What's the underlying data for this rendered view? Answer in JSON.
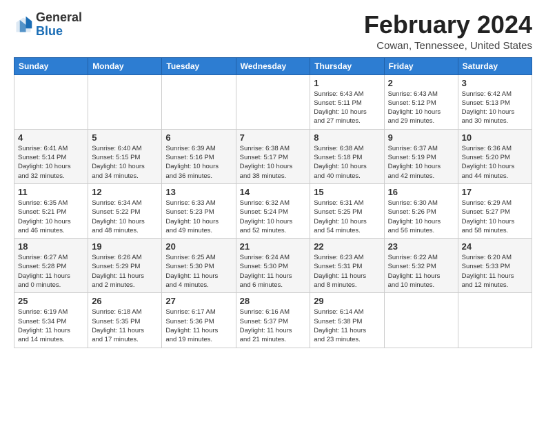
{
  "header": {
    "logo_general": "General",
    "logo_blue": "Blue",
    "month_title": "February 2024",
    "location": "Cowan, Tennessee, United States"
  },
  "calendar": {
    "days_of_week": [
      "Sunday",
      "Monday",
      "Tuesday",
      "Wednesday",
      "Thursday",
      "Friday",
      "Saturday"
    ],
    "weeks": [
      [
        {
          "day": "",
          "info": ""
        },
        {
          "day": "",
          "info": ""
        },
        {
          "day": "",
          "info": ""
        },
        {
          "day": "",
          "info": ""
        },
        {
          "day": "1",
          "info": "Sunrise: 6:43 AM\nSunset: 5:11 PM\nDaylight: 10 hours\nand 27 minutes."
        },
        {
          "day": "2",
          "info": "Sunrise: 6:43 AM\nSunset: 5:12 PM\nDaylight: 10 hours\nand 29 minutes."
        },
        {
          "day": "3",
          "info": "Sunrise: 6:42 AM\nSunset: 5:13 PM\nDaylight: 10 hours\nand 30 minutes."
        }
      ],
      [
        {
          "day": "4",
          "info": "Sunrise: 6:41 AM\nSunset: 5:14 PM\nDaylight: 10 hours\nand 32 minutes."
        },
        {
          "day": "5",
          "info": "Sunrise: 6:40 AM\nSunset: 5:15 PM\nDaylight: 10 hours\nand 34 minutes."
        },
        {
          "day": "6",
          "info": "Sunrise: 6:39 AM\nSunset: 5:16 PM\nDaylight: 10 hours\nand 36 minutes."
        },
        {
          "day": "7",
          "info": "Sunrise: 6:38 AM\nSunset: 5:17 PM\nDaylight: 10 hours\nand 38 minutes."
        },
        {
          "day": "8",
          "info": "Sunrise: 6:38 AM\nSunset: 5:18 PM\nDaylight: 10 hours\nand 40 minutes."
        },
        {
          "day": "9",
          "info": "Sunrise: 6:37 AM\nSunset: 5:19 PM\nDaylight: 10 hours\nand 42 minutes."
        },
        {
          "day": "10",
          "info": "Sunrise: 6:36 AM\nSunset: 5:20 PM\nDaylight: 10 hours\nand 44 minutes."
        }
      ],
      [
        {
          "day": "11",
          "info": "Sunrise: 6:35 AM\nSunset: 5:21 PM\nDaylight: 10 hours\nand 46 minutes."
        },
        {
          "day": "12",
          "info": "Sunrise: 6:34 AM\nSunset: 5:22 PM\nDaylight: 10 hours\nand 48 minutes."
        },
        {
          "day": "13",
          "info": "Sunrise: 6:33 AM\nSunset: 5:23 PM\nDaylight: 10 hours\nand 49 minutes."
        },
        {
          "day": "14",
          "info": "Sunrise: 6:32 AM\nSunset: 5:24 PM\nDaylight: 10 hours\nand 52 minutes."
        },
        {
          "day": "15",
          "info": "Sunrise: 6:31 AM\nSunset: 5:25 PM\nDaylight: 10 hours\nand 54 minutes."
        },
        {
          "day": "16",
          "info": "Sunrise: 6:30 AM\nSunset: 5:26 PM\nDaylight: 10 hours\nand 56 minutes."
        },
        {
          "day": "17",
          "info": "Sunrise: 6:29 AM\nSunset: 5:27 PM\nDaylight: 10 hours\nand 58 minutes."
        }
      ],
      [
        {
          "day": "18",
          "info": "Sunrise: 6:27 AM\nSunset: 5:28 PM\nDaylight: 11 hours\nand 0 minutes."
        },
        {
          "day": "19",
          "info": "Sunrise: 6:26 AM\nSunset: 5:29 PM\nDaylight: 11 hours\nand 2 minutes."
        },
        {
          "day": "20",
          "info": "Sunrise: 6:25 AM\nSunset: 5:30 PM\nDaylight: 11 hours\nand 4 minutes."
        },
        {
          "day": "21",
          "info": "Sunrise: 6:24 AM\nSunset: 5:30 PM\nDaylight: 11 hours\nand 6 minutes."
        },
        {
          "day": "22",
          "info": "Sunrise: 6:23 AM\nSunset: 5:31 PM\nDaylight: 11 hours\nand 8 minutes."
        },
        {
          "day": "23",
          "info": "Sunrise: 6:22 AM\nSunset: 5:32 PM\nDaylight: 11 hours\nand 10 minutes."
        },
        {
          "day": "24",
          "info": "Sunrise: 6:20 AM\nSunset: 5:33 PM\nDaylight: 11 hours\nand 12 minutes."
        }
      ],
      [
        {
          "day": "25",
          "info": "Sunrise: 6:19 AM\nSunset: 5:34 PM\nDaylight: 11 hours\nand 14 minutes."
        },
        {
          "day": "26",
          "info": "Sunrise: 6:18 AM\nSunset: 5:35 PM\nDaylight: 11 hours\nand 17 minutes."
        },
        {
          "day": "27",
          "info": "Sunrise: 6:17 AM\nSunset: 5:36 PM\nDaylight: 11 hours\nand 19 minutes."
        },
        {
          "day": "28",
          "info": "Sunrise: 6:16 AM\nSunset: 5:37 PM\nDaylight: 11 hours\nand 21 minutes."
        },
        {
          "day": "29",
          "info": "Sunrise: 6:14 AM\nSunset: 5:38 PM\nDaylight: 11 hours\nand 23 minutes."
        },
        {
          "day": "",
          "info": ""
        },
        {
          "day": "",
          "info": ""
        }
      ]
    ]
  }
}
